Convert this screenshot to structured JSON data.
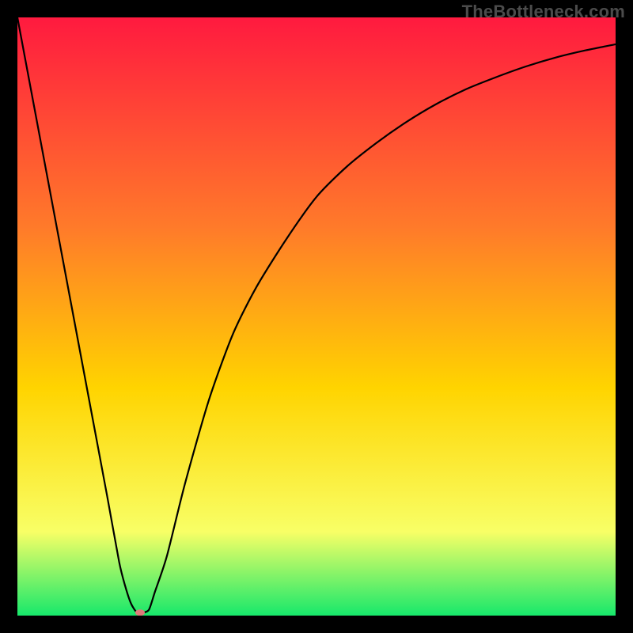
{
  "watermark": "TheBottleneck.com",
  "chart_data": {
    "type": "line",
    "title": "",
    "xlabel": "",
    "ylabel": "",
    "xlim": [
      0,
      100
    ],
    "ylim": [
      0,
      100
    ],
    "grid": false,
    "legend": false,
    "background_gradient": {
      "top": "#ff1a3f",
      "mid1": "#ff7a2a",
      "mid2": "#ffd400",
      "mid3": "#f8ff66",
      "bottom": "#17e86b"
    },
    "series": [
      {
        "name": "curve",
        "color": "#000000",
        "x": [
          0,
          3,
          6,
          9,
          12,
          15,
          17,
          18,
          19,
          20,
          21,
          22,
          23,
          25,
          28,
          32,
          36,
          40,
          45,
          50,
          55,
          60,
          65,
          70,
          75,
          80,
          85,
          90,
          95,
          100
        ],
        "y": [
          100,
          84,
          68,
          52,
          36,
          20,
          9,
          5,
          2,
          0.5,
          0.5,
          1,
          4,
          10,
          22,
          36,
          47,
          55,
          63,
          70,
          75,
          79,
          82.5,
          85.5,
          88,
          90,
          91.8,
          93.3,
          94.5,
          95.5
        ]
      }
    ],
    "marker": {
      "x": 20.5,
      "y": 0.5,
      "color": "#e07a7a",
      "rx": 6,
      "ry": 4
    }
  }
}
